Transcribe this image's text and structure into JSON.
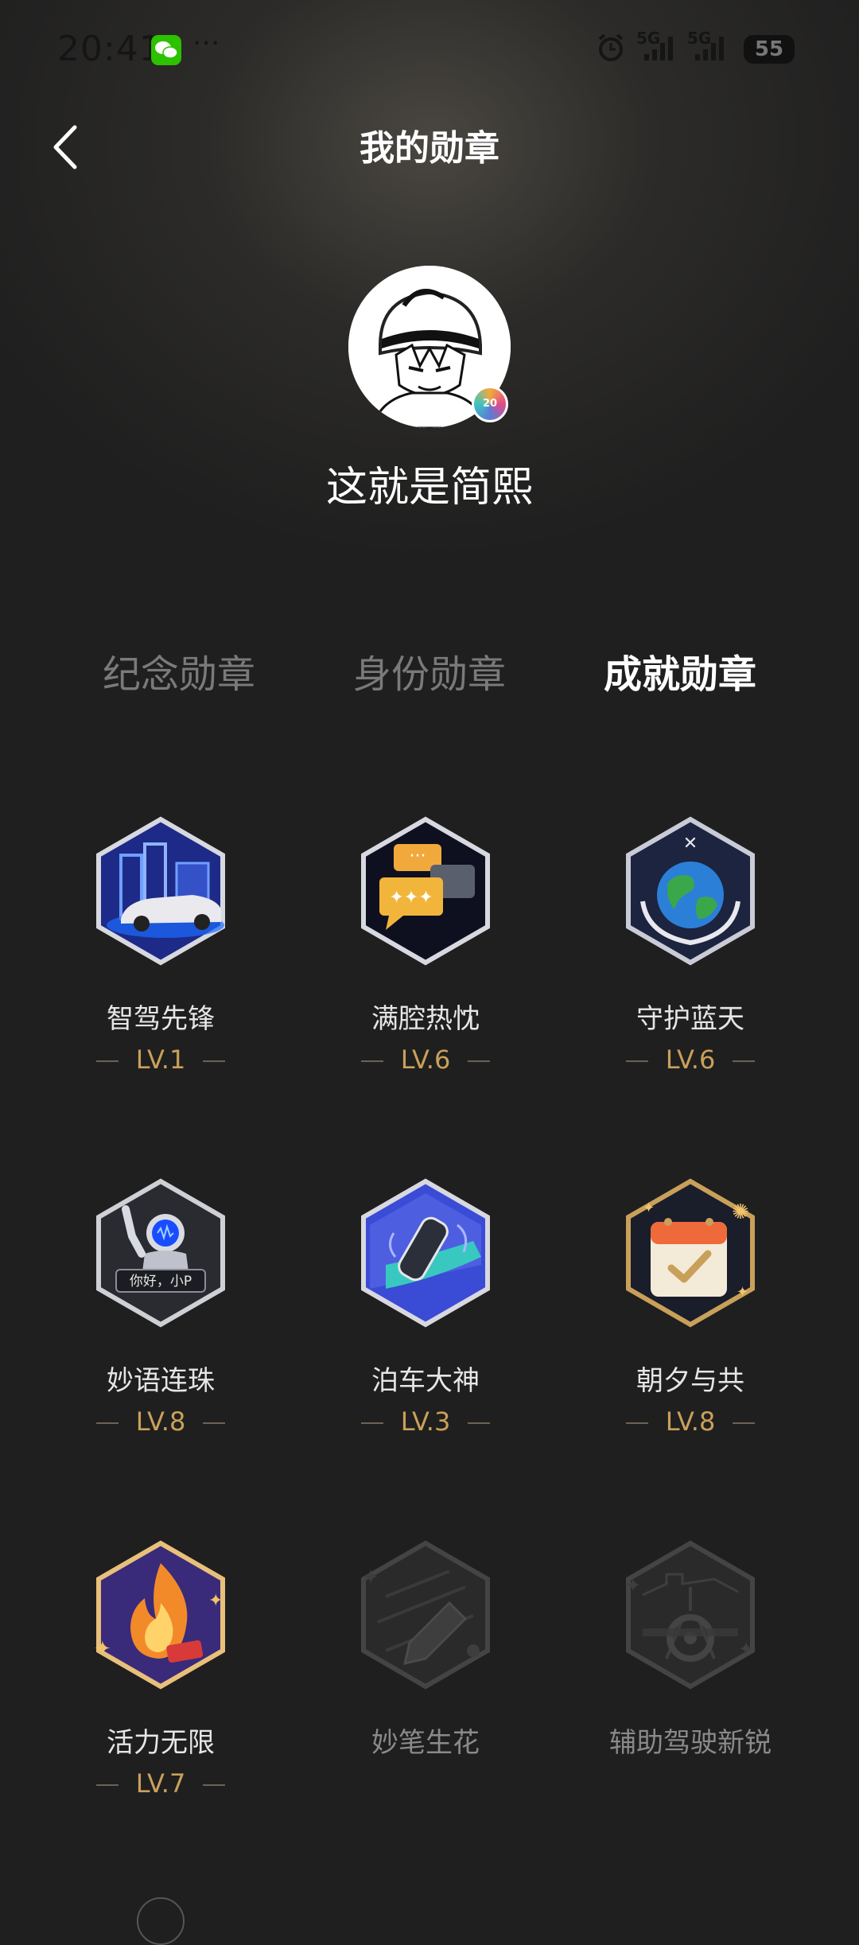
{
  "status_bar": {
    "time": "20:41",
    "dots": "···",
    "network_1": "5G",
    "network_2": "5G",
    "battery": "55",
    "icons": [
      "wechat-icon",
      "alarm-icon",
      "signal-icon",
      "battery-icon"
    ]
  },
  "header": {
    "title": "我的勋章",
    "back_icon": "chevron-left-icon"
  },
  "profile": {
    "username": "这就是简熙",
    "avatar_badge": "20"
  },
  "tabs": [
    {
      "label": "纪念勋章",
      "active": false
    },
    {
      "label": "身份勋章",
      "active": false
    },
    {
      "label": "成就勋章",
      "active": true
    }
  ],
  "badges": [
    {
      "name": "智驾先锋",
      "level": "LV.1",
      "icon": "smart-driving-car-icon",
      "unlocked": true
    },
    {
      "name": "满腔热忱",
      "level": "LV.6",
      "icon": "chat-bubbles-icon",
      "unlocked": true
    },
    {
      "name": "守护蓝天",
      "level": "LV.6",
      "icon": "earth-hands-icon",
      "unlocked": true
    },
    {
      "name": "妙语连珠",
      "level": "LV.8",
      "icon": "robot-assistant-icon",
      "unlocked": true
    },
    {
      "name": "泊车大神",
      "level": "LV.3",
      "icon": "parking-car-icon",
      "unlocked": true
    },
    {
      "name": "朝夕与共",
      "level": "LV.8",
      "icon": "calendar-check-icon",
      "unlocked": true
    },
    {
      "name": "活力无限",
      "level": "LV.7",
      "icon": "fire-icon",
      "unlocked": true
    },
    {
      "name": "妙笔生花",
      "level": "",
      "icon": "pen-icon",
      "unlocked": false
    },
    {
      "name": "辅助驾驶新锐",
      "level": "",
      "icon": "steering-road-icon",
      "unlocked": false
    }
  ],
  "robot_badge_text": "你好，小P",
  "colors": {
    "background": "#1f1f1f",
    "level_gold": "#c9a05a",
    "tab_inactive": "#7a7a7a",
    "tab_active": "#ffffff"
  }
}
